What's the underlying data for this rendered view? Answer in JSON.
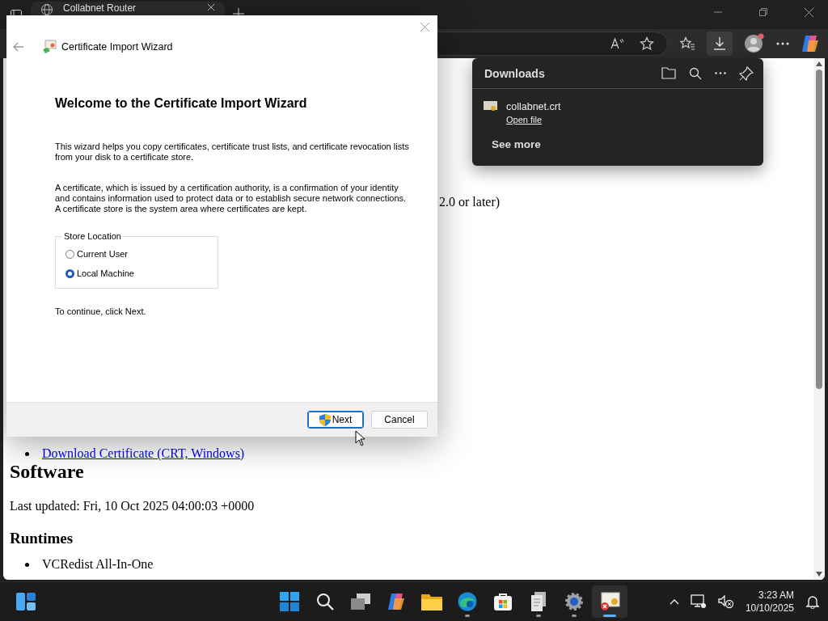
{
  "browser": {
    "tab": {
      "title": "Collabnet Router"
    }
  },
  "downloads": {
    "title": "Downloads",
    "items": [
      {
        "name": "collabnet.crt",
        "action": "Open file"
      }
    ],
    "see_more": "See more"
  },
  "page": {
    "fragment": "2.0 or later)",
    "links": [
      "Download Certificate (CRT, Windows)"
    ],
    "heading": "Software",
    "updated": "Last updated: Fri, 10 Oct 2025 04:00:03 +0000",
    "subheading": "Runtimes",
    "items": [
      "VCRedist All-In-One"
    ]
  },
  "dialog": {
    "title": "Certificate Import Wizard",
    "heading": "Welcome to the Certificate Import Wizard",
    "paragraphs": [
      "This wizard helps you copy certificates, certificate trust lists, and certificate revocation lists from your disk to a certificate store.",
      "A certificate, which is issued by a certification authority, is a confirmation of your identity and contains information used to protect data or to establish secure network connections. A certificate store is the system area where certificates are kept."
    ],
    "store_location": {
      "label": "Store Location",
      "options": [
        {
          "label": "Current User",
          "selected": false
        },
        {
          "label": "Local Machine",
          "selected": true
        }
      ]
    },
    "hint": "To continue, click Next.",
    "buttons": [
      {
        "label": "Next",
        "default": true
      },
      {
        "label": "Cancel",
        "default": false
      }
    ]
  },
  "taskbar": {
    "apps": [
      {
        "kind": "start",
        "running": false,
        "active": false
      },
      {
        "kind": "search",
        "running": false,
        "active": false
      },
      {
        "kind": "taskview",
        "running": false,
        "active": false
      },
      {
        "kind": "copilot",
        "running": false,
        "active": false
      },
      {
        "kind": "files",
        "running": false,
        "active": false
      },
      {
        "kind": "edge",
        "running": true,
        "active": false
      },
      {
        "kind": "store",
        "running": false,
        "active": false
      },
      {
        "kind": "docs",
        "running": true,
        "active": false
      },
      {
        "kind": "settings",
        "running": true,
        "active": false
      },
      {
        "kind": "certificate",
        "running": true,
        "active": true
      }
    ],
    "time": "3:23 AM",
    "date": "10/10/2025"
  }
}
